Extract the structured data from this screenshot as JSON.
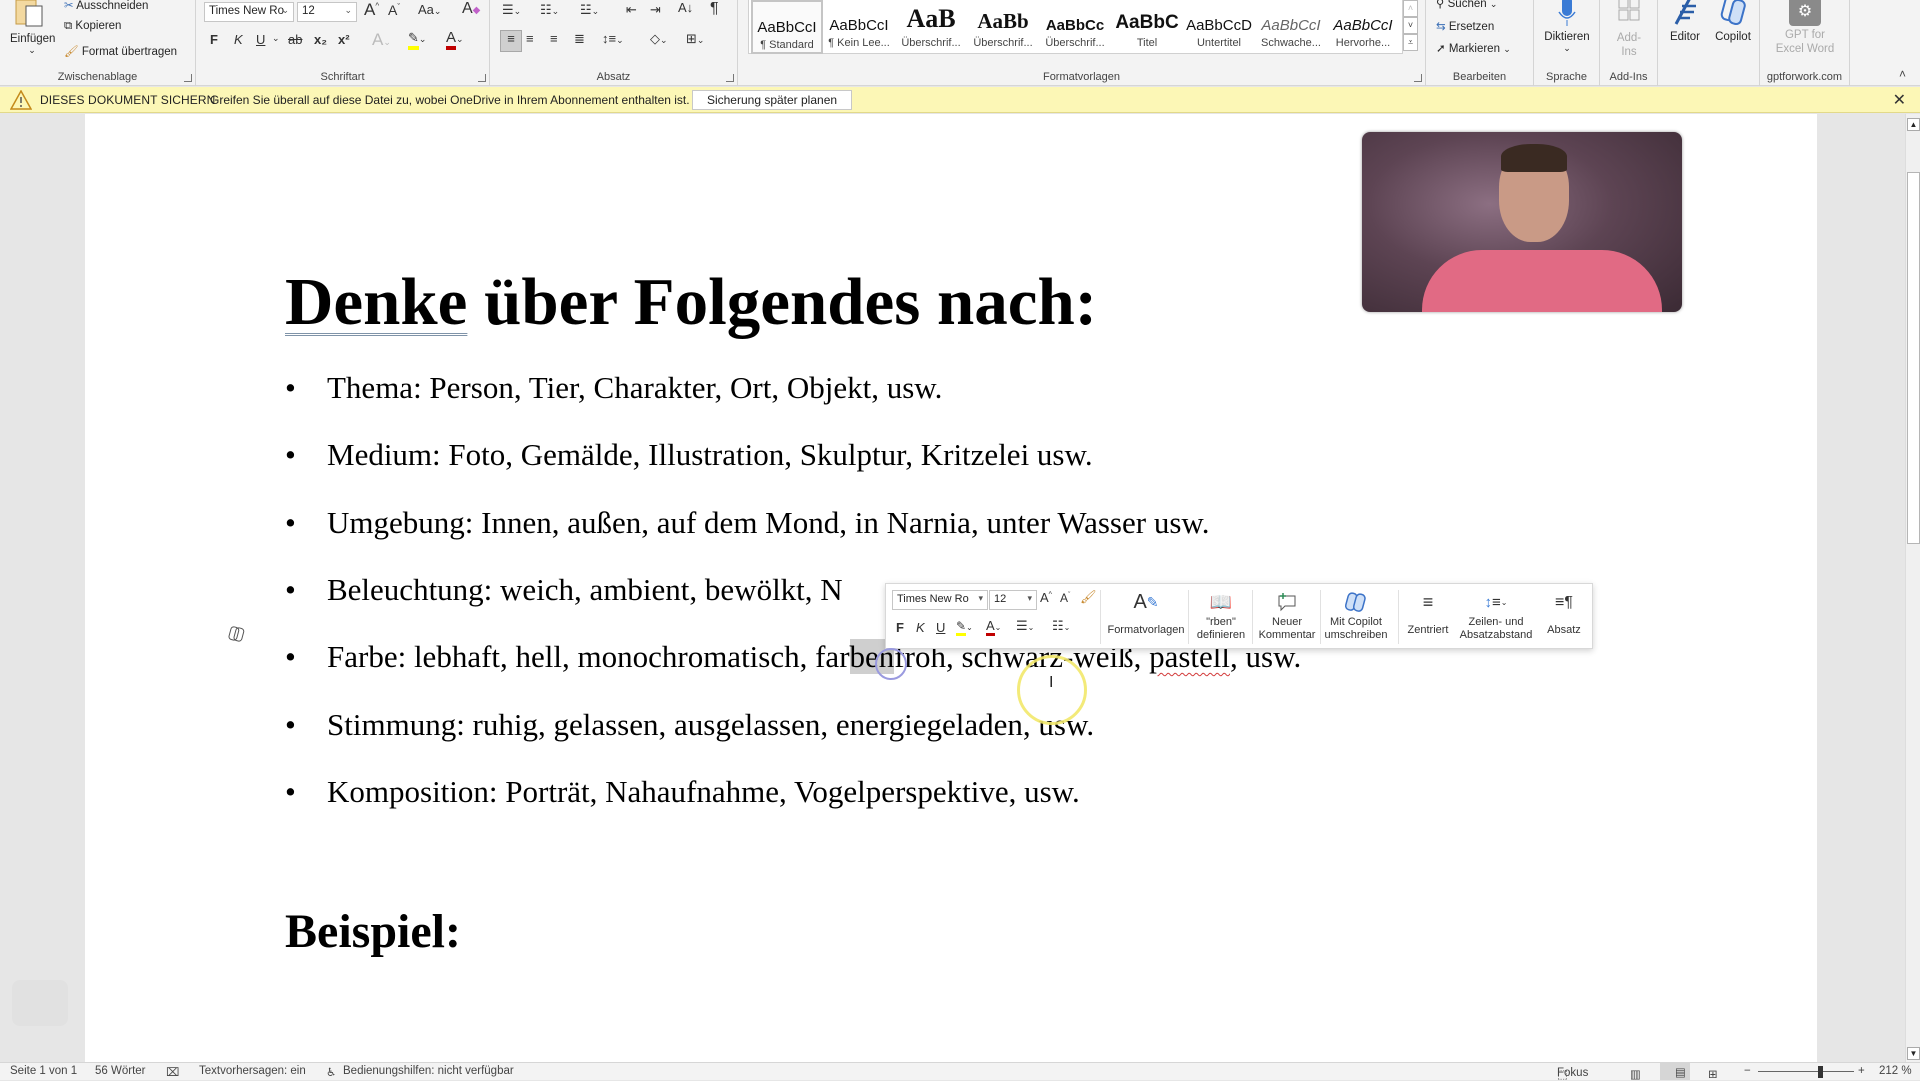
{
  "ribbon": {
    "clipboard": {
      "paste_label": "Einfügen",
      "cut_label": "Ausschneiden",
      "copy_label": "Kopieren",
      "format_painter_label": "Format übertragen",
      "group_label": "Zwischenablage"
    },
    "font": {
      "font_name": "Times New Ro",
      "font_size": "12",
      "case_label": "Aa",
      "bold": "F",
      "italic": "K",
      "underline": "U",
      "strikethrough": "ab",
      "subscript": "x₂",
      "superscript": "x²",
      "grow": "A",
      "shrink": "A",
      "group_label": "Schriftart",
      "highlight_color": "#ffff00",
      "font_color": "#c00000"
    },
    "paragraph": {
      "group_label": "Absatz",
      "pilcrow": "¶"
    },
    "styles": {
      "group_label": "Formatvorlagen",
      "items": [
        {
          "preview": "AaBbCcI",
          "name": "¶ Standard",
          "selected": true
        },
        {
          "preview": "AaBbCcI",
          "name": "¶ Kein Lee..."
        },
        {
          "preview": "AaB",
          "name": "Überschrif..."
        },
        {
          "preview": "AaBb",
          "name": "Überschrif..."
        },
        {
          "preview": "AaBbCc",
          "name": "Überschrif..."
        },
        {
          "preview": "AaBbC",
          "name": "Titel"
        },
        {
          "preview": "AaBbCcD",
          "name": "Untertitel"
        },
        {
          "preview": "AaBbCcI",
          "name": "Schwache..."
        },
        {
          "preview": "AaBbCcI",
          "name": "Hervorhe..."
        }
      ]
    },
    "editing": {
      "group_label": "Bearbeiten",
      "find_label": "Suchen",
      "replace_label": "Ersetzen",
      "select_label": "Markieren"
    },
    "voice": {
      "group_label": "Sprache",
      "dictate_label": "Diktieren"
    },
    "addins": {
      "group_label": "Add-Ins",
      "addins_label": "Add-Ins"
    },
    "editor_label": "Editor",
    "copilot_label": "Copilot",
    "gpt": {
      "label": "GPT for Excel Word",
      "group_label": "gptforwork.com"
    }
  },
  "message_bar": {
    "title": "DIESES DOKUMENT SICHERN",
    "text": "Greifen Sie überall auf diese Datei zu, wobei OneDrive in Ihrem Abonnement enthalten ist.",
    "button_label": "Sicherung später planen",
    "close": "✕"
  },
  "document": {
    "title_underlined": "Denke",
    "title_rest": " über Folgendes nach:",
    "bullets": [
      "Thema: Person, Tier, Charakter, Ort, Objekt, usw.",
      "Medium: Foto, Gemälde, Illustration, Skulptur, Kritzelei usw.",
      "Umgebung: Innen, außen, auf dem Mond, in Narnia, unter Wasser usw.",
      "Beleuchtung: weich, ambient, bewölkt, N",
      "Farbe: lebhaft, hell, monochromatisch, farbenfroh, schwarz-weiß, pastell, usw.",
      "Stimmung: ruhig, gelassen, ausgelassen, energiegeladen, usw.",
      "Komposition: Porträt, Nahaufnahme, Vogelperspektive, usw."
    ],
    "farbe_parts": {
      "a": "Farbe: lebhaft, hell, monochromatisch, far",
      "sel": "ben",
      "b": "froh, schwarz-weiß, ",
      "misspelled": "pastell",
      "c": ", usw."
    },
    "heading2": "Beispiel:",
    "bullet_glyph": "•"
  },
  "floating_toolbar": {
    "font_name": "Times New Ro",
    "font_size": "12",
    "bold": "F",
    "italic": "K",
    "underline": "U",
    "styles_label": "Formatvorlagen",
    "define_label_1": "\"rben\"",
    "define_label_2": "definieren",
    "comment_label_1": "Neuer",
    "comment_label_2": "Kommentar",
    "copilot_label_1": "Mit Copilot",
    "copilot_label_2": "umschreiben",
    "center_label": "Zentriert",
    "spacing_label_1": "Zeilen- und",
    "spacing_label_2": "Absatzabstand",
    "paragraph_label": "Absatz"
  },
  "status_bar": {
    "page": "Seite 1 von 1",
    "words": "56 Wörter",
    "text_predictions": "Textvorhersagen: ein",
    "accessibility": "Bedienungshilfen: nicht verfügbar",
    "focus": "Fokus",
    "zoom": "212 %",
    "zoom_minus": "−",
    "zoom_plus": "+"
  }
}
